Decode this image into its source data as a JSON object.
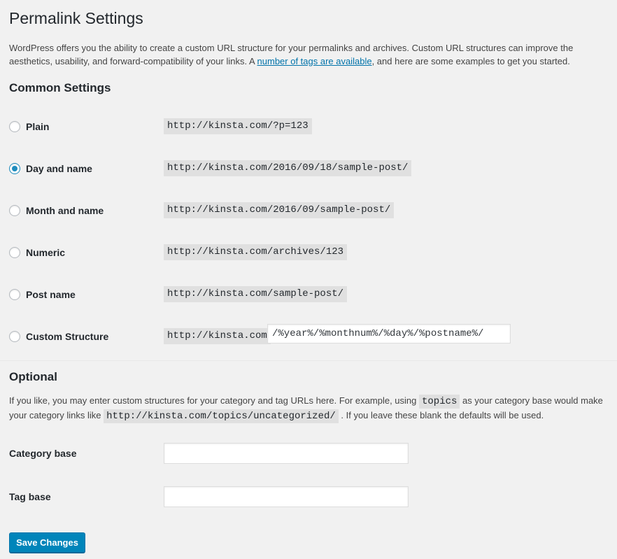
{
  "page": {
    "title": "Permalink Settings",
    "intro_before_link": "WordPress offers you the ability to create a custom URL structure for your permalinks and archives. Custom URL structures can improve the aesthetics, usability, and forward-compatibility of your links. A ",
    "intro_link": "number of tags are available",
    "intro_after_link": ", and here are some examples to get you started."
  },
  "common": {
    "heading": "Common Settings",
    "options": [
      {
        "label": "Plain",
        "example": "http://kinsta.com/?p=123",
        "checked": false
      },
      {
        "label": "Day and name",
        "example": "http://kinsta.com/2016/09/18/sample-post/",
        "checked": true
      },
      {
        "label": "Month and name",
        "example": "http://kinsta.com/2016/09/sample-post/",
        "checked": false
      },
      {
        "label": "Numeric",
        "example": "http://kinsta.com/archives/123",
        "checked": false
      },
      {
        "label": "Post name",
        "example": "http://kinsta.com/sample-post/",
        "checked": false
      },
      {
        "label": "Custom Structure",
        "example": "http://kinsta.com",
        "checked": false
      }
    ],
    "custom_structure_value": "/%year%/%monthnum%/%day%/%postname%/"
  },
  "optional": {
    "heading": "Optional",
    "text_1": "If you like, you may enter custom structures for your category and tag URLs here. For example, using ",
    "code_1": "topics",
    "text_2": " as your category base would make your category links like ",
    "code_2": "http://kinsta.com/topics/uncategorized/",
    "text_3": " . If you leave these blank the defaults will be used.",
    "category_base_label": "Category base",
    "category_base_value": "",
    "tag_base_label": "Tag base",
    "tag_base_value": ""
  },
  "actions": {
    "save_label": "Save Changes"
  },
  "colors": {
    "background": "#f1f1f1",
    "link": "#0073aa",
    "primary_button": "#0085ba",
    "radio_checked": "#1e8cbe"
  }
}
